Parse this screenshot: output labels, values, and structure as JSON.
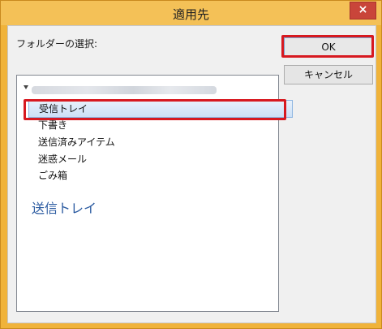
{
  "window": {
    "title": "適用先",
    "close_glyph": "×"
  },
  "dialog": {
    "folder_select_label": "フォルダーの選択:",
    "ok_label": "OK",
    "cancel_label": "キャンセル"
  },
  "tree": {
    "folders": [
      {
        "label": "受信トレイ",
        "selected": true
      },
      {
        "label": "下書き"
      },
      {
        "label": "送信済みアイテム"
      },
      {
        "label": "迷惑メール"
      },
      {
        "label": "ごみ箱"
      }
    ],
    "selected_caption": "送信トレイ"
  },
  "colors": {
    "title_bar": "#f4c157",
    "highlight": "#d71920",
    "selection": "#cce0f6"
  }
}
